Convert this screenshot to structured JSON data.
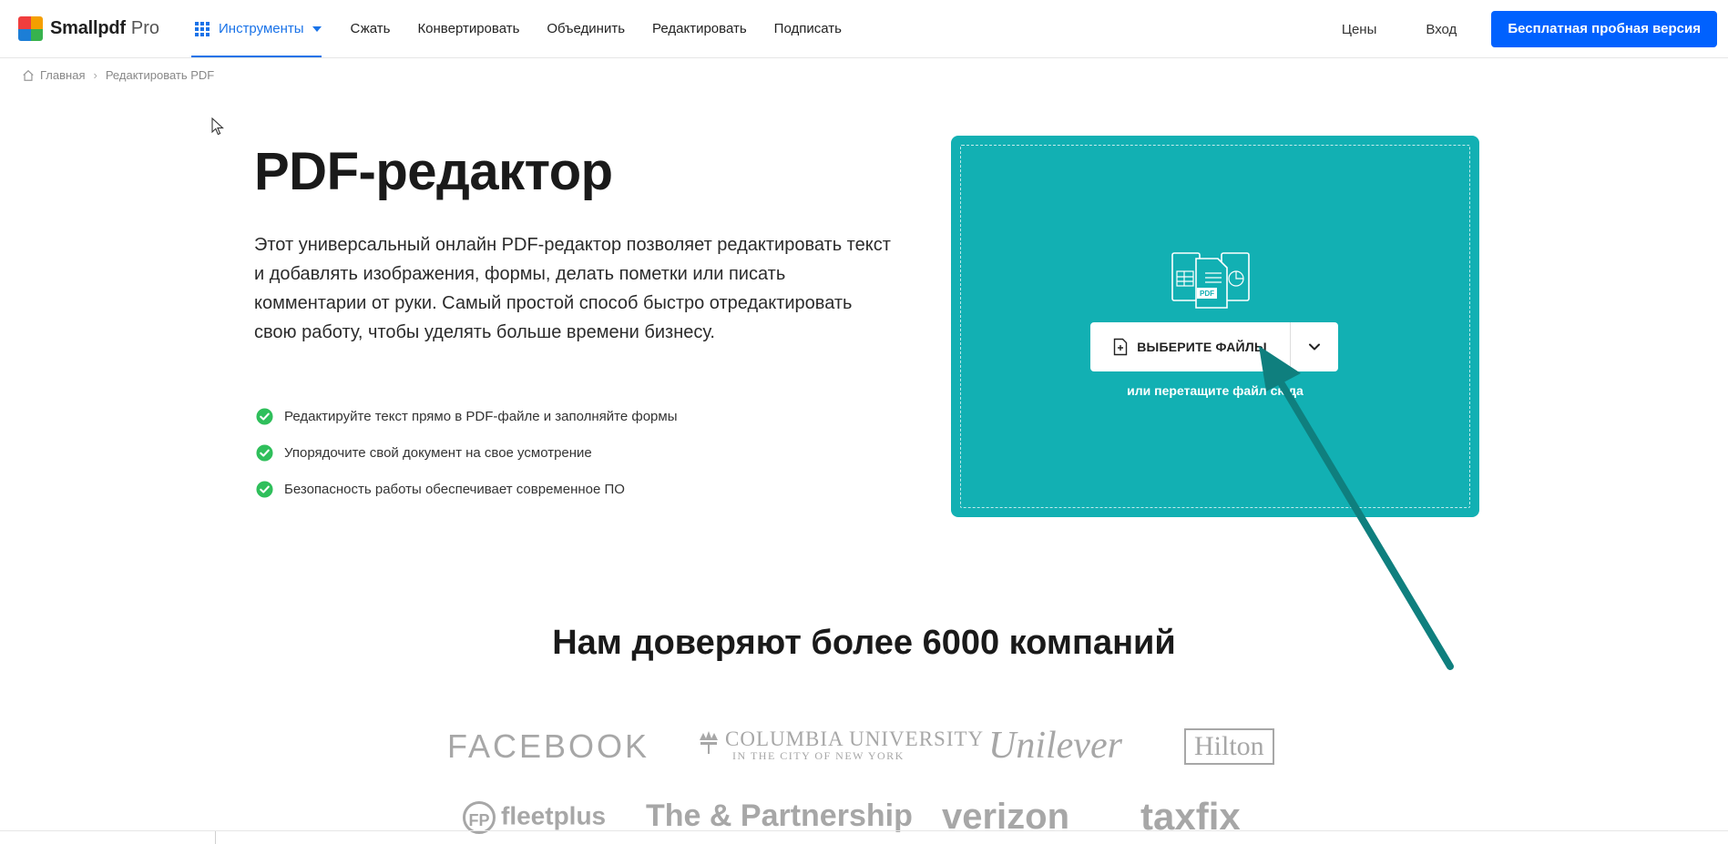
{
  "header": {
    "brand": "Smallpdf",
    "brand_suffix": "Pro",
    "nav": {
      "tools_label": "Инструменты",
      "items": [
        "Сжать",
        "Конвертировать",
        "Объединить",
        "Редактировать",
        "Подписать"
      ]
    },
    "pricing_label": "Цены",
    "login_label": "Вход",
    "cta_label": "Бесплатная пробная версия",
    "logo_colors": [
      "#f03e3e",
      "#f59f00",
      "#1c7ed6",
      "#37b24d"
    ]
  },
  "breadcrumb": {
    "home": "Главная",
    "current": "Редактировать PDF"
  },
  "hero": {
    "title": "PDF-редактор",
    "description": "Этот универсальный онлайн PDF-редактор позволяет редактировать текст и добавлять изображения, формы, делать пометки или писать комментарии от руки. Самый простой способ быстро отредактировать свою работу, чтобы уделять больше времени бизнесу.",
    "features": [
      "Редактируйте текст прямо в PDF-файле и заполняйте формы",
      "Упорядочите свой документ на свое усмотрение",
      "Безопасность работы обеспечивает современное ПО"
    ]
  },
  "dropzone": {
    "choose_label": "ВЫБЕРИТЕ ФАЙЛЫ",
    "hint": "или перетащите файл сюда",
    "accent": "#12b0b3",
    "illustration_badge": "PDF"
  },
  "trust": {
    "title": "Нам доверяют более 6000 компаний",
    "logos": {
      "facebook": "FACEBOOK",
      "columbia_1": "COLUMBIA UNIVERSITY",
      "columbia_2": "IN THE CITY OF NEW YORK",
      "unilever": "Unilever",
      "hilton": "Hilton",
      "fleetplus_mark": "FP",
      "fleetplus": "fleetplus",
      "and_partnership": "The & Partnership",
      "verizon": "verizon",
      "taxfix": "taxfix"
    }
  }
}
